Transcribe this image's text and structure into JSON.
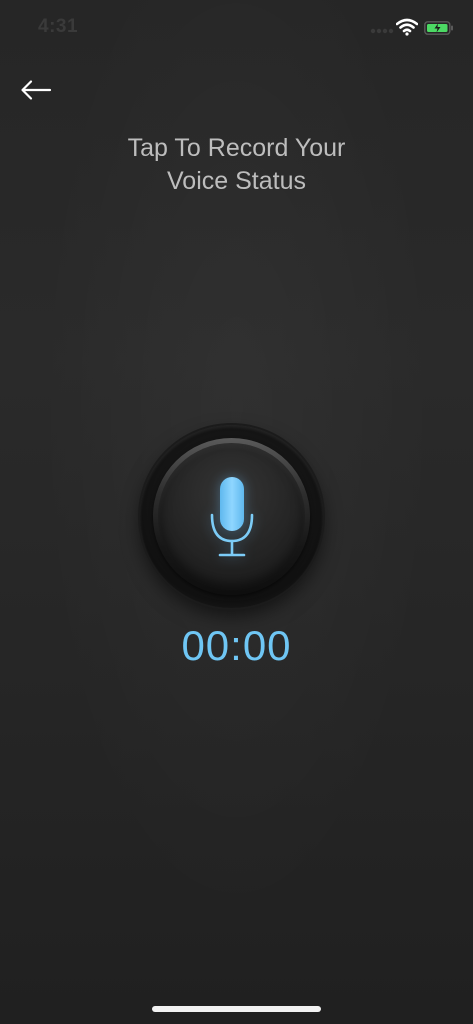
{
  "status_bar": {
    "time": "4:31",
    "icons": [
      "signal-icon",
      "wifi-icon",
      "battery-icon"
    ]
  },
  "header": {
    "back_icon": "back-arrow-icon"
  },
  "title": {
    "line1": "Tap To Record Your",
    "line2": "Voice Status"
  },
  "recorder": {
    "icon": "microphone-icon",
    "timer": "00:00"
  },
  "colors": {
    "accent": "#6fc6f4",
    "background": "#262626",
    "title_text": "#bdbdbd",
    "battery_green": "#4cd964"
  }
}
